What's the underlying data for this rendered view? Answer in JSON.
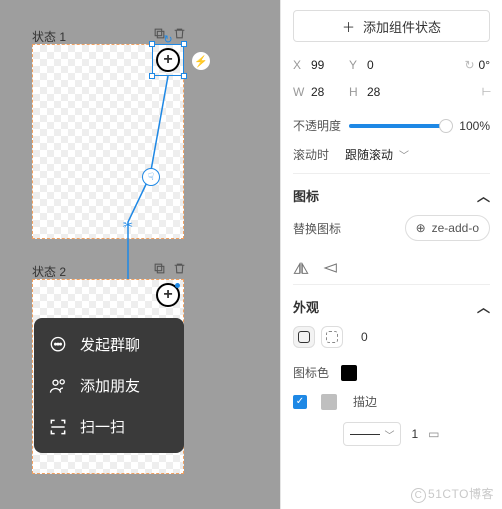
{
  "canvas": {
    "state1_label": "状态 1",
    "state2_label": "状态 2",
    "menu": {
      "items": [
        {
          "icon": "chat-icon",
          "label": "发起群聊"
        },
        {
          "icon": "add-friend-icon",
          "label": "添加朋友"
        },
        {
          "icon": "scan-icon",
          "label": "扫一扫"
        }
      ]
    }
  },
  "panel": {
    "add_state_label": "添加组件状态",
    "transform": {
      "x_label": "X",
      "x": "99",
      "y_label": "Y",
      "y": "0",
      "r_label": "0°",
      "w_label": "W",
      "w": "28",
      "h_label": "H",
      "h": "28"
    },
    "opacity": {
      "label": "不透明度",
      "value": "100%",
      "percent": 100
    },
    "scroll": {
      "label": "滚动时",
      "value": "跟随滚动"
    },
    "icon_section": {
      "title": "图标",
      "replace_label": "替换图标",
      "icon_name": "ze-add-o"
    },
    "appearance": {
      "title": "外观",
      "radius_value": "0",
      "icon_color_label": "图标色",
      "stroke_label": "描边",
      "stroke_value": "1"
    }
  },
  "watermark_logo": "C",
  "watermark": "51CTO博客"
}
